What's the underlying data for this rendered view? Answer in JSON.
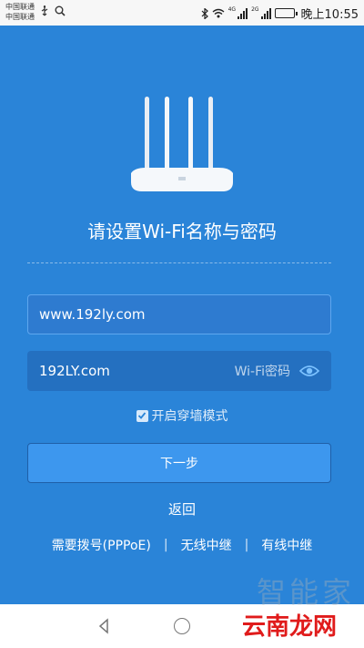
{
  "status_bar": {
    "carrier_1": "中国联通",
    "carrier_2": "中国联通",
    "network_1": "4G",
    "network_2": "2G",
    "time": "晚上10:55",
    "battery_color": "#2db24a"
  },
  "setup": {
    "title": "请设置Wi-Fi名称与密码",
    "ssid_value": "www.192ly.com",
    "password_value": "192LY.com",
    "password_placeholder": "Wi-Fi密码",
    "wall_mode_label": "开启穿墙模式",
    "wall_mode_checked": true,
    "next_button": "下一步",
    "back_link": "返回",
    "links": [
      "需要拨号(PPPoE)",
      "无线中继",
      "有线中继"
    ],
    "separator": "|"
  },
  "watermark": {
    "faded": "智能家",
    "brand": "云南龙网"
  },
  "colors": {
    "background": "#2a84d8",
    "button": "#3d97ee",
    "field": "#2470c0"
  }
}
